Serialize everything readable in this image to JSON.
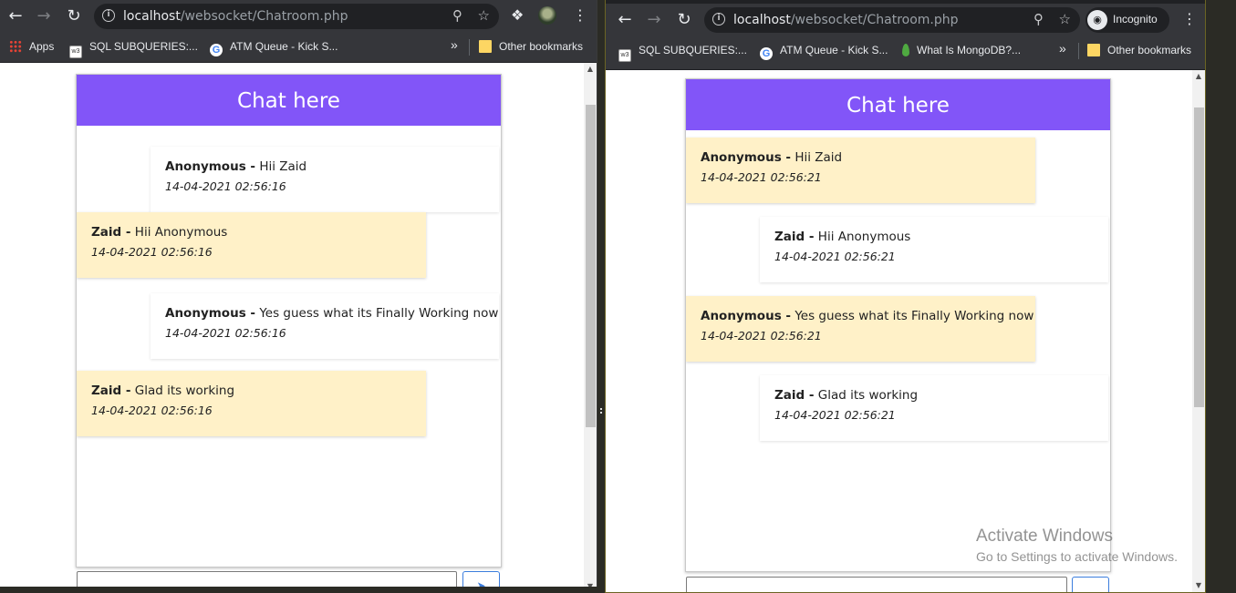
{
  "left_window": {
    "url_host": "localhost",
    "url_path": "/websocket/Chatroom.php",
    "bookmarks": [
      {
        "label": "Apps",
        "icon": "apps-grid-icon"
      },
      {
        "label": "SQL SUBQUERIES:...",
        "icon": "w3schools-icon"
      },
      {
        "label": "ATM Queue - Kick S...",
        "icon": "google-icon"
      }
    ],
    "overflow_label": "»",
    "other_bookmarks": "Other bookmarks",
    "chat": {
      "header": "Chat here",
      "messages": [
        {
          "name": "Anonymous -",
          "text": "Hii Zaid",
          "time": "14-04-2021 02:56:16",
          "style": "white"
        },
        {
          "name": "Zaid -",
          "text": "Hii Anonymous",
          "time": "14-04-2021 02:56:16",
          "style": "yellow"
        },
        {
          "name": "Anonymous -",
          "text": "Yes guess what its Finally Working now",
          "time": "14-04-2021 02:56:16",
          "style": "white"
        },
        {
          "name": "Zaid -",
          "text": "Glad its working",
          "time": "14-04-2021 02:56:16",
          "style": "yellow"
        }
      ],
      "send_icon": "send-arrow-icon"
    }
  },
  "right_window": {
    "url_host": "localhost",
    "url_path": "/websocket/Chatroom.php",
    "incognito_label": "Incognito",
    "bookmarks": [
      {
        "label": "SQL SUBQUERIES:...",
        "icon": "w3schools-icon"
      },
      {
        "label": "ATM Queue - Kick S...",
        "icon": "google-icon"
      },
      {
        "label": "What Is MongoDB?...",
        "icon": "mongodb-icon"
      }
    ],
    "overflow_label": "»",
    "other_bookmarks": "Other bookmarks",
    "chat": {
      "header": "Chat here",
      "messages": [
        {
          "name": "Anonymous -",
          "text": "Hii Zaid",
          "time": "14-04-2021 02:56:21",
          "style": "yellow"
        },
        {
          "name": "Zaid -",
          "text": "Hii Anonymous",
          "time": "14-04-2021 02:56:21",
          "style": "white"
        },
        {
          "name": "Anonymous -",
          "text": "Yes guess what its Finally Working now",
          "time": "14-04-2021 02:56:21",
          "style": "yellow"
        },
        {
          "name": "Zaid -",
          "text": "Glad its working",
          "time": "14-04-2021 02:56:21",
          "style": "white"
        }
      ]
    }
  },
  "watermark": {
    "line1": "Activate Windows",
    "line2": "Go to Settings to activate Windows."
  },
  "colors": {
    "chat_header": "#8255f8",
    "message_yellow": "#fff1c8",
    "browser_chrome": "#35363a",
    "send_button_accent": "#3b7ddd"
  }
}
